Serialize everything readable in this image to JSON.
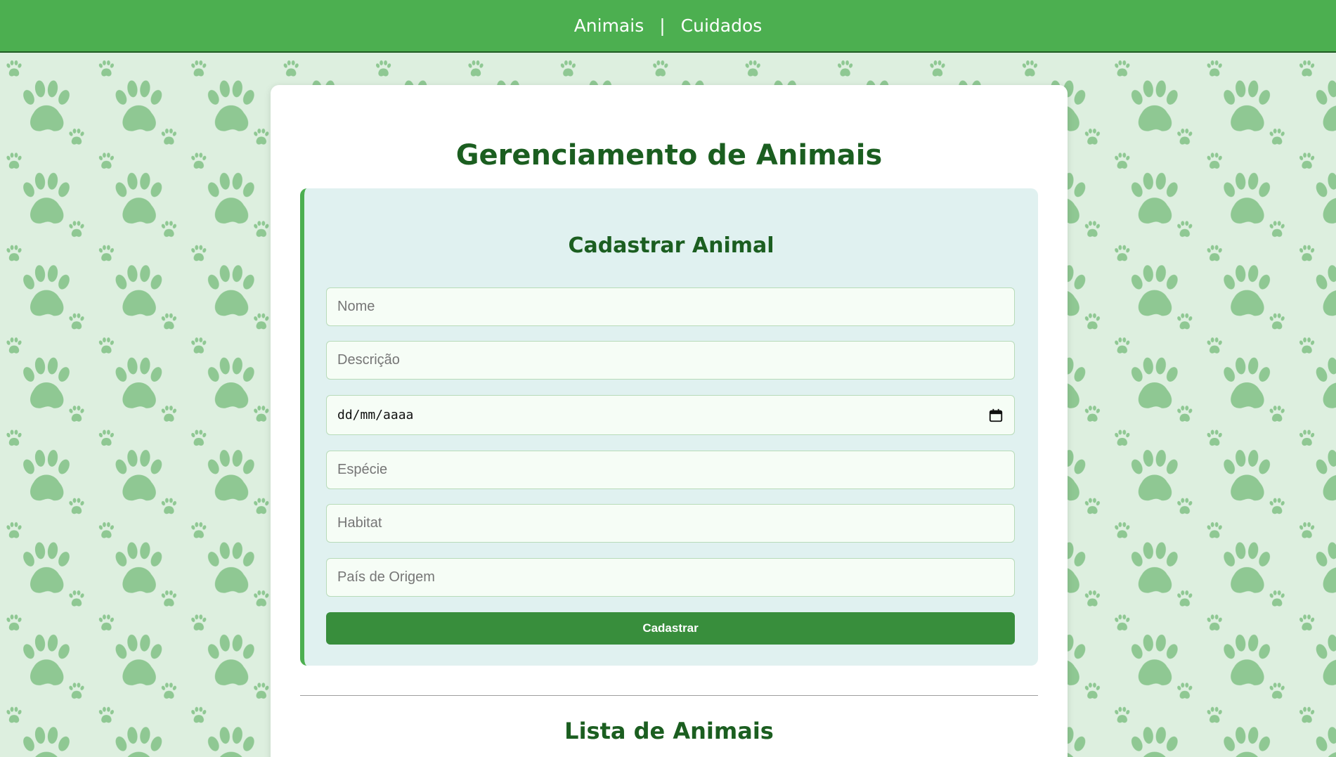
{
  "nav": {
    "items": [
      "Animais",
      "Cuidados"
    ],
    "separator": "|"
  },
  "page": {
    "title": "Gerenciamento de Animais"
  },
  "form": {
    "title": "Cadastrar Animal",
    "name_placeholder": "Nome",
    "description_placeholder": "Descrição",
    "date_placeholder": "dd/mm/aaaa",
    "species_placeholder": "Espécie",
    "habitat_placeholder": "Habitat",
    "country_placeholder": "País de Origem",
    "submit_label": "Cadastrar"
  },
  "list": {
    "title": "Lista de Animais"
  },
  "colors": {
    "navbar": "#4caf50",
    "title": "#1b5e20",
    "button": "#388e3c",
    "form_bg": "#e0f1f0",
    "page_bg": "#ddefdf",
    "paw": "#8fc893"
  },
  "icons": {
    "background_pattern": "paw-print-icon",
    "date_picker": "calendar-icon"
  }
}
